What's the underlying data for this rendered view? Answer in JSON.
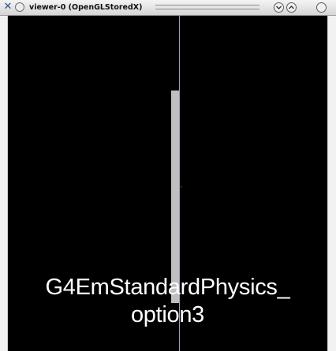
{
  "window": {
    "title": "viewer-0 (OpenGLStoredX)"
  },
  "icons": {
    "close": "close-x-icon",
    "pin": "circle-icon",
    "minimize": "chevron-down-icon",
    "maximize": "chevron-up-icon"
  },
  "colors": {
    "viewport_background": "#000000",
    "detector": "#bfbfbf",
    "axis": "#9aa4b4",
    "text": "#ffffff"
  },
  "viewer": {
    "overlay_line1": "G4EmStandardPhysics_",
    "overlay_line2": "option3"
  }
}
